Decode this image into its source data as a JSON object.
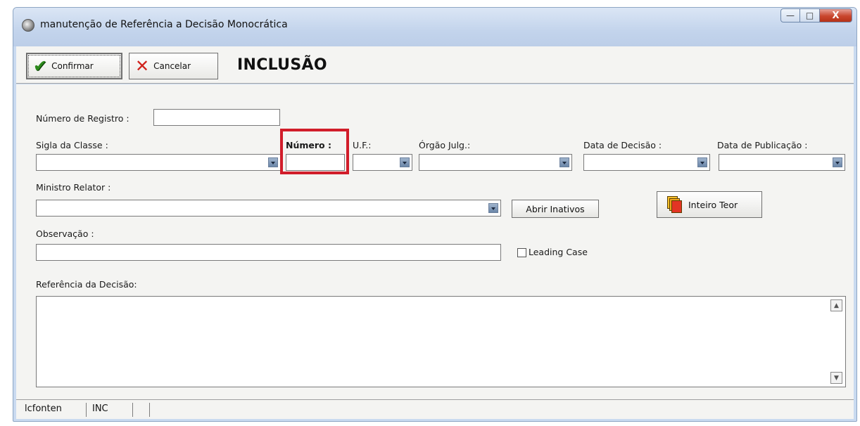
{
  "window": {
    "title": "manutenção de Referência a Decisão Monocrática",
    "controls": {
      "minimize": "—",
      "maximize": "□",
      "close": "X"
    }
  },
  "toolbar": {
    "confirm_label": "Confirmar",
    "cancel_label": "Cancelar",
    "mode": "INCLUSÃO"
  },
  "form": {
    "numero_registro_label": "Número de Registro :",
    "numero_registro_value": "",
    "sigla_classe_label": "Sigla da Classe :",
    "sigla_classe_value": "",
    "numero_label": "Número :",
    "numero_value": "",
    "uf_label": "U.F.:",
    "uf_value": "",
    "orgao_label": "Órgão Julg.:",
    "orgao_value": "",
    "data_decisao_label": "Data de Decisão :",
    "data_decisao_value": "",
    "data_publicacao_label": "Data de Publicação :",
    "data_publicacao_value": "",
    "ministro_label": "Ministro Relator :",
    "ministro_value": "",
    "abrir_inativos_label": "Abrir Inativos",
    "inteiro_teor_label": "Inteiro Teor",
    "observacao_label": "Observação :",
    "observacao_value": "",
    "leading_case_label": "Leading Case",
    "leading_case_checked": false,
    "referencia_label": "Referência da Decisão:",
    "referencia_value": ""
  },
  "statusbar": {
    "panel_user": "lcfonten",
    "panel_mode": "INC",
    "panel_extra": ""
  },
  "colors": {
    "highlight": "#d11d2a",
    "confirm_icon": "#2d8a1c",
    "cancel_icon": "#d0221c"
  },
  "icons": {
    "confirm": "checkmark-icon",
    "cancel": "x-icon",
    "inteiro_teor": "documents-icon"
  }
}
